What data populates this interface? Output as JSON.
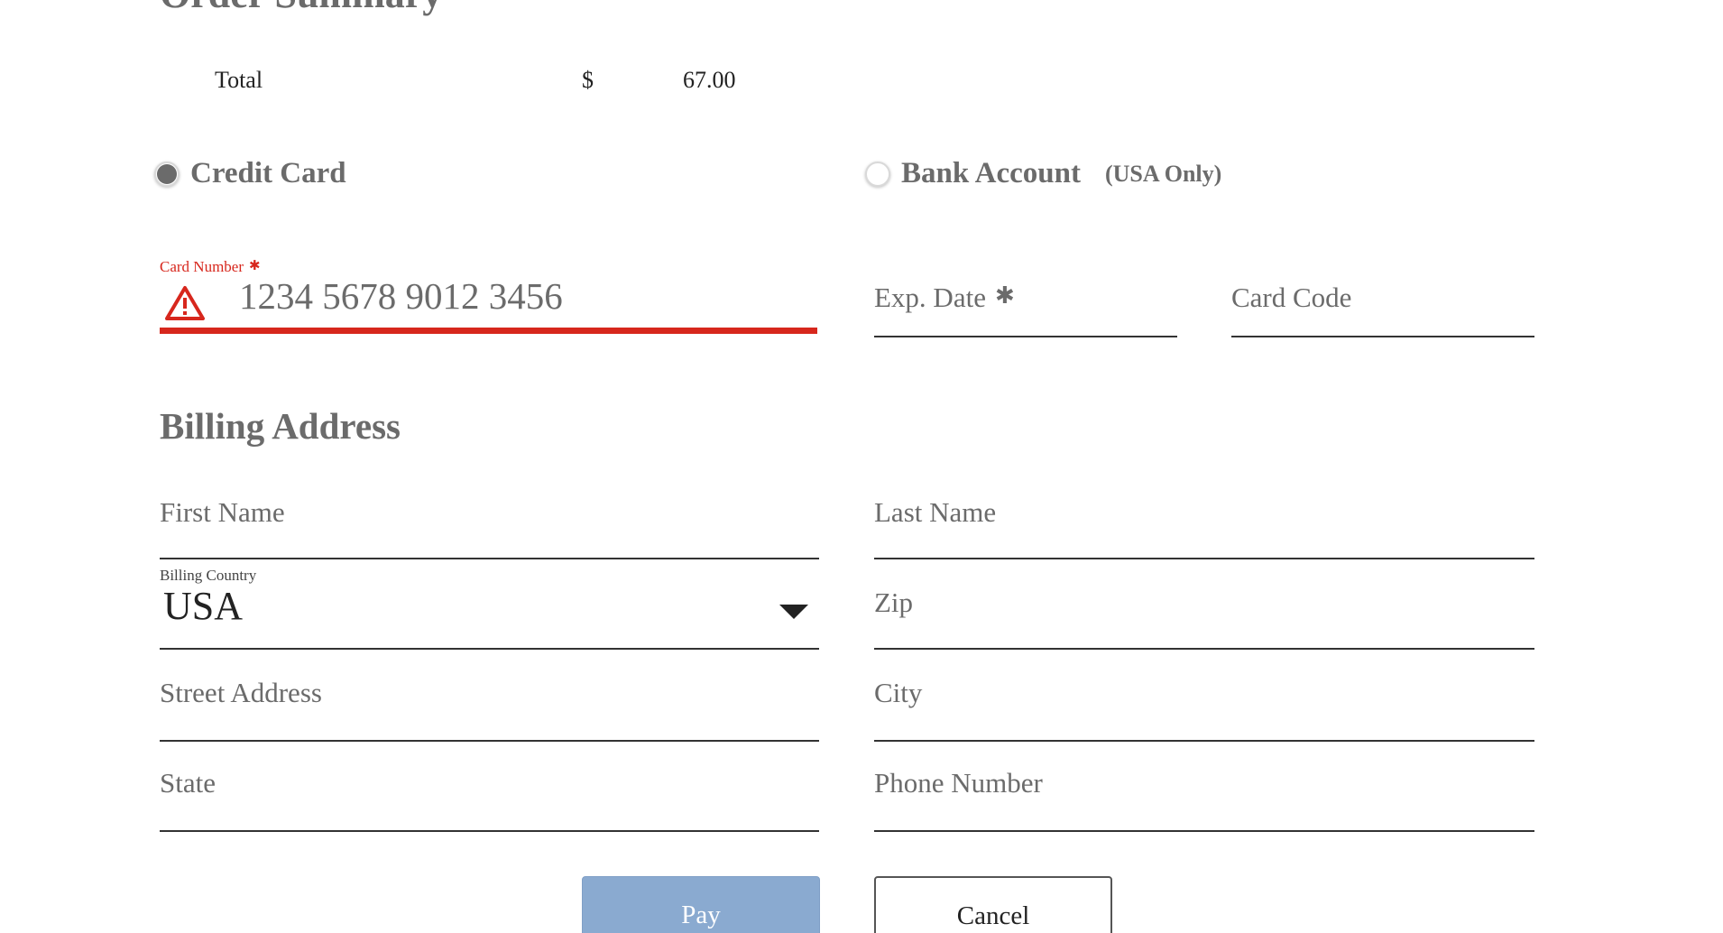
{
  "order_summary": {
    "heading": "Order Summary",
    "total_label": "Total",
    "currency": "$",
    "total_amount": "67.00"
  },
  "payment_method": {
    "options": [
      {
        "label": "Credit Card",
        "selected": true
      },
      {
        "label": "Bank Account",
        "note": "(USA Only)",
        "selected": false
      }
    ]
  },
  "card": {
    "number_label": "Card Number",
    "number_value": "1234 5678 9012 3456",
    "number_error": true,
    "exp_date_placeholder": "Exp. Date",
    "card_code_placeholder": "Card Code",
    "required_marker": "✱"
  },
  "billing": {
    "heading": "Billing Address",
    "first_name_placeholder": "First Name",
    "last_name_placeholder": "Last Name",
    "country_label": "Billing Country",
    "country_value": "USA",
    "zip_placeholder": "Zip",
    "street_placeholder": "Street Address",
    "city_placeholder": "City",
    "state_placeholder": "State",
    "phone_placeholder": "Phone Number"
  },
  "actions": {
    "pay_label": "Pay",
    "cancel_label": "Cancel"
  },
  "colors": {
    "error": "#d7271d",
    "pay_button": "#8aaad0",
    "text_gray": "#6b6b6b"
  },
  "icons": {
    "card_error": "warning-triangle-icon",
    "country_dropdown": "caret-down-icon"
  }
}
